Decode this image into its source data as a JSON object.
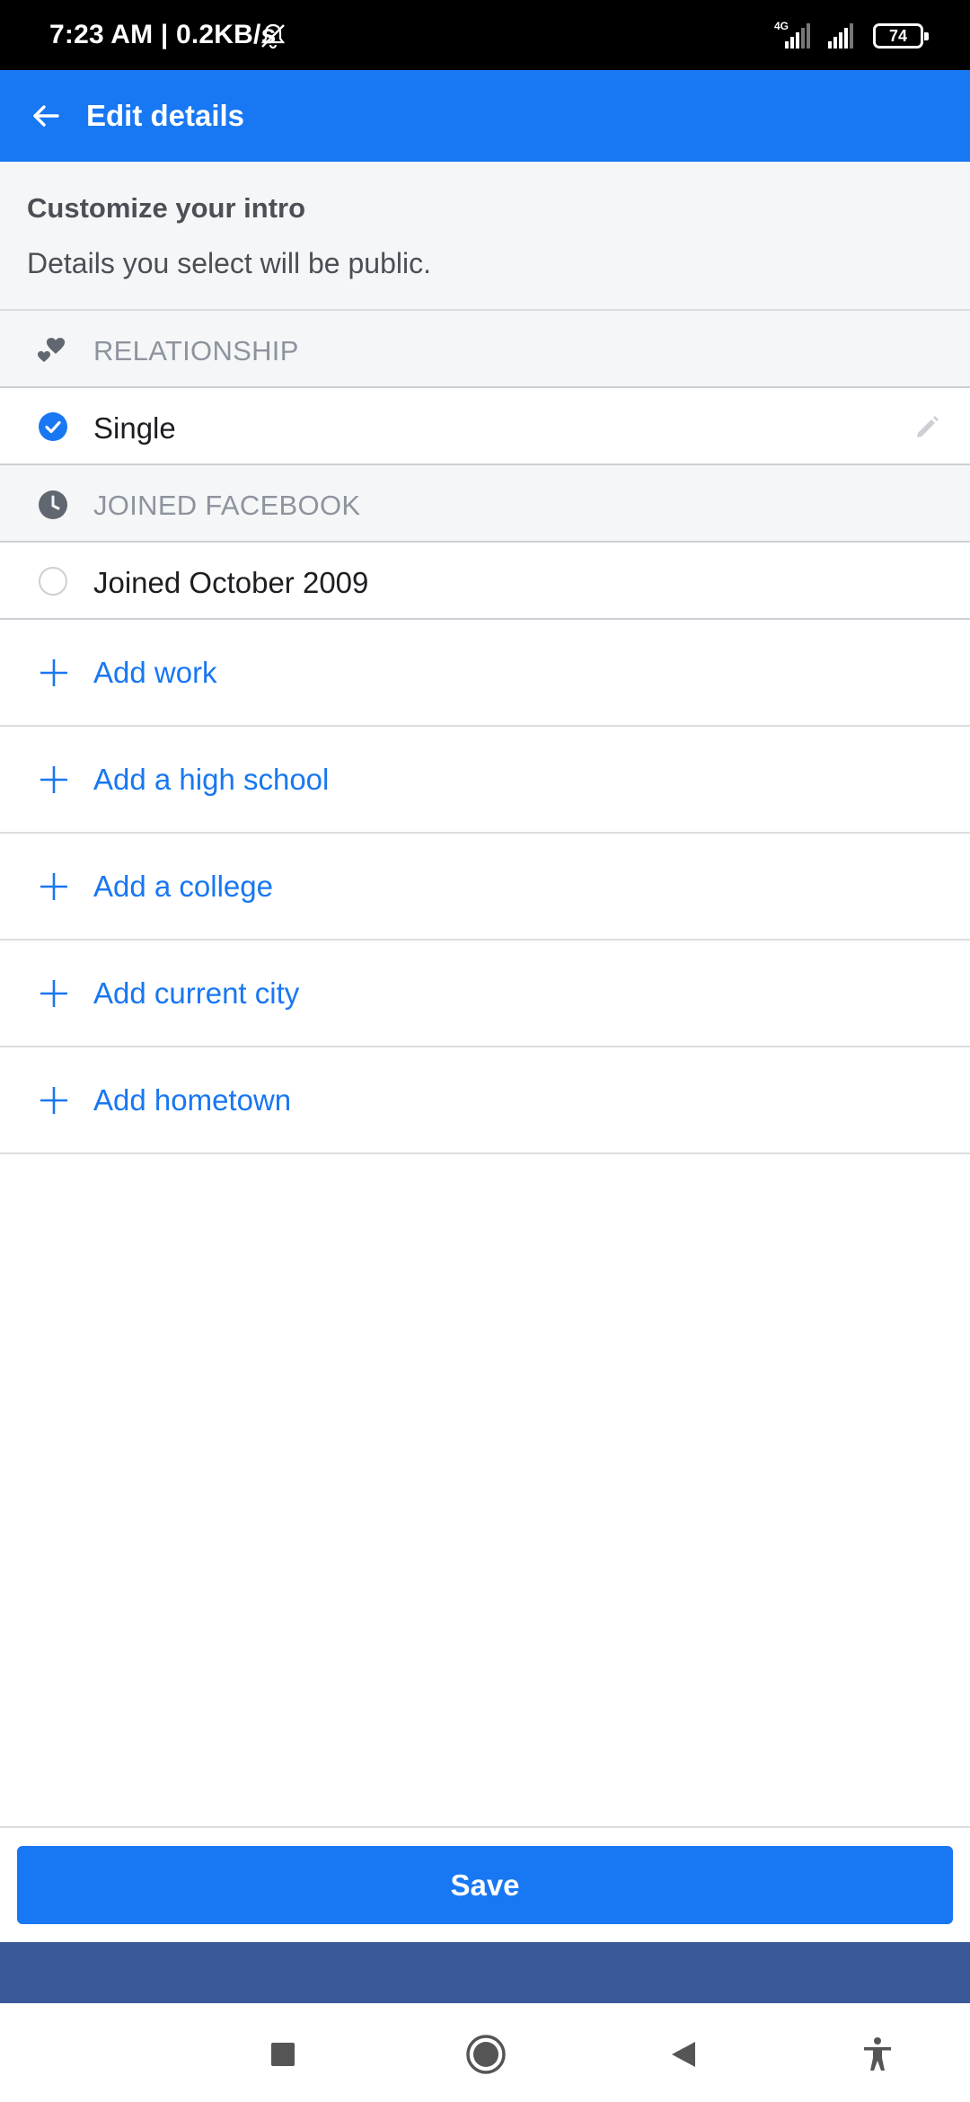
{
  "status_bar": {
    "time": "7:23 AM",
    "separator": " | ",
    "network_speed": "0.2KB/s",
    "network_type": "4G",
    "battery": "74"
  },
  "app_bar": {
    "back_icon": "arrow-left-icon",
    "title": "Edit details",
    "color": "#1877f2"
  },
  "intro": {
    "title": "Customize your intro",
    "subtitle": "Details you select will be public."
  },
  "sections": {
    "relationship": {
      "icon": "hearts-icon",
      "label": "RELATIONSHIP",
      "option": {
        "label": "Single",
        "selected": true,
        "edit_icon": "pencil-icon"
      }
    },
    "joined": {
      "icon": "clock-icon",
      "label": "JOINED FACEBOOK",
      "option": {
        "label": "Joined October 2009",
        "selected": false
      }
    }
  },
  "add_items": [
    {
      "label": "Add work",
      "icon": "plus-icon"
    },
    {
      "label": "Add a high school",
      "icon": "plus-icon"
    },
    {
      "label": "Add a college",
      "icon": "plus-icon"
    },
    {
      "label": "Add current city",
      "icon": "plus-icon"
    },
    {
      "label": "Add hometown",
      "icon": "plus-icon"
    }
  ],
  "save_button": {
    "label": "Save"
  },
  "nav_bar": {
    "items": [
      "recents-square-icon",
      "home-circle-icon",
      "back-triangle-icon",
      "accessibility-icon"
    ]
  }
}
